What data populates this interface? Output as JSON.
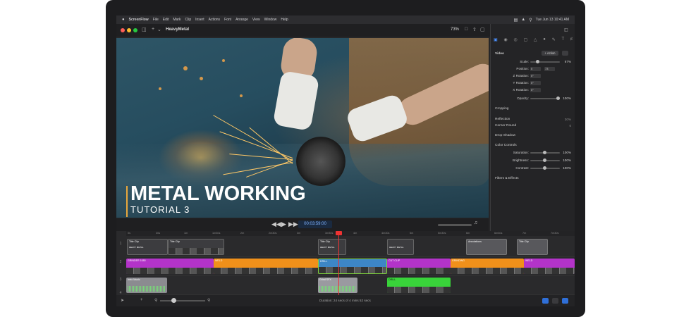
{
  "menubar": {
    "apple": "",
    "app_name": "ScreenFlow",
    "items": [
      "File",
      "Edit",
      "Mark",
      "Clip",
      "Insert",
      "Actions",
      "Font",
      "Arrange",
      "View",
      "Window",
      "Help"
    ],
    "clock": "Tue Jun 13 10:41 AM"
  },
  "window": {
    "title": "HeavyMetal",
    "zoom": "73%"
  },
  "canvas": {
    "title": "METAL WORKING",
    "subtitle": "TUTORIAL 3"
  },
  "transport": {
    "timecode": "00:03:59:00"
  },
  "inspector": {
    "section_title": "Video",
    "action_label": "+ Action",
    "rows": [
      {
        "label": "Scale:",
        "value": "67%"
      },
      {
        "label": "Position:",
        "value": ""
      },
      {
        "label": "Z Rotation:",
        "value": ""
      },
      {
        "label": "Y Rotation:",
        "value": ""
      },
      {
        "label": "X Rotation:",
        "value": ""
      },
      {
        "label": "Opacity:",
        "value": "100%"
      }
    ],
    "position_x": "0",
    "position_y": "73",
    "rot_z": "0°",
    "rot_y": "0°",
    "rot_x": "0°",
    "cropping": "Cropping",
    "reflection": "Reflection",
    "reflection_value": "30%",
    "corner_round": "Corner Round",
    "corner_round_value": "0",
    "drop_shadow": "Drop Shadow",
    "color_controls": "Color Controls",
    "color_rows": [
      {
        "label": "Saturation:",
        "value": "100%"
      },
      {
        "label": "Brightness:",
        "value": "100%"
      },
      {
        "label": "Contrast:",
        "value": "100%"
      }
    ],
    "filters": "Filters & Effects"
  },
  "ruler": [
    "0s",
    "30s",
    "1m",
    "1m30s",
    "2m",
    "2m30s",
    "3m",
    "3m30s",
    "4m",
    "4m30s",
    "5m",
    "5m30s",
    "6m",
    "6m30s",
    "7m",
    "7m30s"
  ],
  "tracks": [
    "1",
    "2",
    "3",
    "4"
  ],
  "clips": {
    "title1": "Title Clip",
    "title2": "Title Clip",
    "title3": "Title Clip",
    "title4": "Annotations",
    "title5": "Title Clip",
    "lower_thirds": [
      "HEAVY METAL",
      "HEAVY METAL",
      "HEAVY METAL"
    ],
    "grinder_clip": "GRINDER 1080",
    "weld": "WELD",
    "weld2": "WELD",
    "drill": "DRILL",
    "cut_clip": "CUT CLIP",
    "grinding": "GRINDING",
    "audio1": "Intro Music",
    "audio2": "Grind SFX",
    "green_clip": "DRILL"
  },
  "footer": {
    "duration": "Duration: 24 secs of 4 mins 52 secs"
  },
  "colors": {
    "purple_clip": "#b333c9",
    "orange_clip": "#f0901a",
    "green_clip": "#39d33a",
    "blue_accent": "#4a8df8",
    "playhead": "#e33333"
  }
}
